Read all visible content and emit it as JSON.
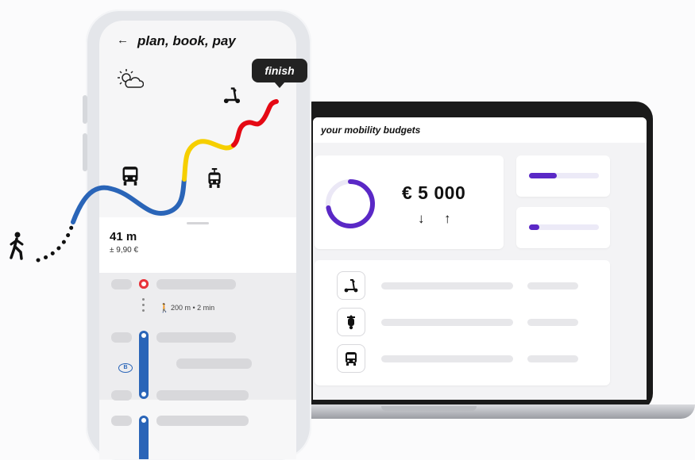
{
  "phone": {
    "back_icon": "←",
    "title": "plan, book, pay",
    "finish_label": "finish",
    "trip": {
      "duration": "41 m",
      "price": "± 9,90 €"
    },
    "walk_leg": "200 m • 2 min",
    "rail_badge": "B",
    "route_colors": [
      "#2a65b8",
      "#f6cf00",
      "#e50914"
    ],
    "icons": [
      "weather-icon",
      "scooter-icon",
      "bus-icon",
      "tram-icon",
      "walking-person-icon"
    ]
  },
  "laptop": {
    "header_title": "your mobility budgets",
    "budget": {
      "amount": "€ 5 000",
      "down_arrow": "↓",
      "up_arrow": "↑",
      "ring_fraction": 0.72,
      "ring_color": "#5a28c6"
    },
    "bars": [
      {
        "fill_fraction": 0.4
      },
      {
        "fill_fraction": 0.15
      }
    ],
    "vehicles": [
      "scooter-icon",
      "moped-icon",
      "bus-icon"
    ]
  }
}
